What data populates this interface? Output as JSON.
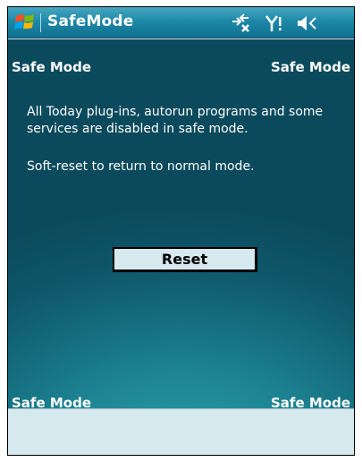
{
  "titlebar": {
    "title": "SafeMode",
    "icons": [
      "windows-start-icon",
      "connectivity-icon",
      "signal-icon",
      "volume-icon"
    ]
  },
  "main": {
    "corner_top_left": "Safe Mode",
    "corner_top_right": "Safe Mode",
    "corner_bottom_left": "Safe Mode",
    "corner_bottom_right": "Safe Mode",
    "message_line1": "All Today plug-ins, autorun programs and some services are disabled in safe mode.",
    "message_line2": "Soft-reset to return to normal mode.",
    "reset_label": "Reset"
  },
  "colors": {
    "titlebar": "#1e88a8",
    "background": "#0e5568",
    "softkey_bar": "#d6e9ee",
    "text": "#ffffff"
  }
}
